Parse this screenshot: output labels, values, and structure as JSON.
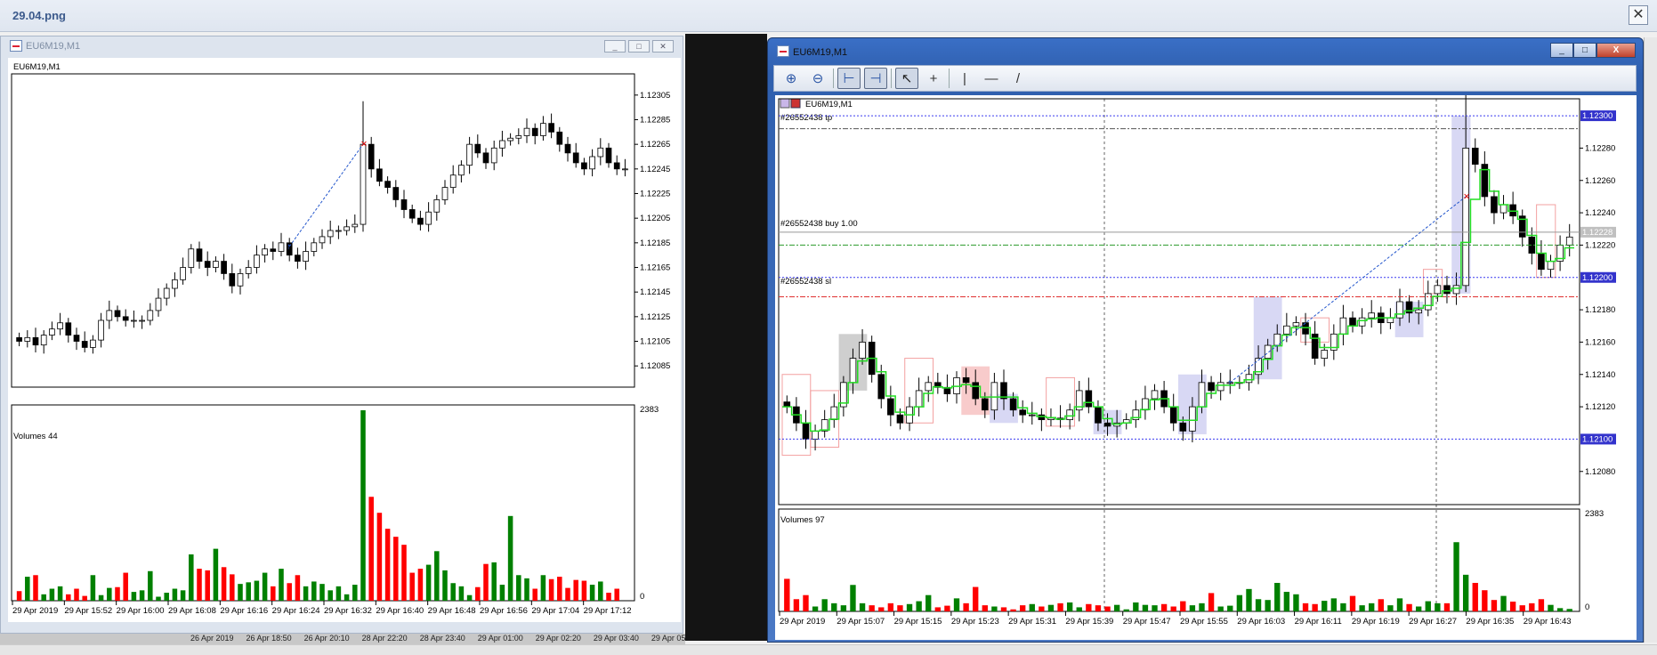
{
  "viewer": {
    "title": "29.04.png",
    "close_icon": "✕"
  },
  "left_window": {
    "title": "EU6M19,M1",
    "chart_label": "EU6M19,M1",
    "volumes_label": "Volumes 44",
    "price_ticks": [
      "1.12305",
      "1.12285",
      "1.12265",
      "1.12245",
      "1.12225",
      "1.12205",
      "1.12185",
      "1.12165",
      "1.12145",
      "1.12125",
      "1.12105",
      "1.12085"
    ],
    "price_range": [
      1.12075,
      1.12315
    ],
    "volume_ticks": [
      "2383",
      "0"
    ],
    "time_ticks": [
      "29 Apr 2019",
      "29 Apr 15:52",
      "29 Apr 16:00",
      "29 Apr 16:08",
      "29 Apr 16:16",
      "29 Apr 16:24",
      "29 Apr 16:32",
      "29 Apr 16:40",
      "29 Apr 16:48",
      "29 Apr 16:56",
      "29 Apr 17:04",
      "29 Apr 17:12"
    ],
    "closes": [
      1.12105,
      1.12108,
      1.12102,
      1.1211,
      1.12115,
      1.1212,
      1.1211,
      1.12105,
      1.121,
      1.12106,
      1.12122,
      1.1213,
      1.12125,
      1.12122,
      1.12122,
      1.12122,
      1.1213,
      1.1214,
      1.12148,
      1.12155,
      1.12165,
      1.1218,
      1.1217,
      1.12165,
      1.1217,
      1.1216,
      1.1215,
      1.1216,
      1.12165,
      1.12175,
      1.1218,
      1.12178,
      1.12185,
      1.12175,
      1.1217,
      1.12178,
      1.12185,
      1.1219,
      1.12195,
      1.12195,
      1.12198,
      1.122,
      1.12265,
      1.12245,
      1.12235,
      1.1223,
      1.1222,
      1.12212,
      1.12205,
      1.122,
      1.1221,
      1.1222,
      1.1223,
      1.1224,
      1.12248,
      1.12265,
      1.12258,
      1.1225,
      1.12262,
      1.12268,
      1.1227,
      1.12272,
      1.12278,
      1.12272,
      1.12282,
      1.12275,
      1.12265,
      1.12258,
      1.1225,
      1.12245,
      1.12255,
      1.12262,
      1.1225,
      1.12245,
      1.12245
    ],
    "volumes": [
      120,
      300,
      320,
      80,
      150,
      180,
      80,
      150,
      60,
      320,
      70,
      160,
      170,
      350,
      110,
      130,
      370,
      50,
      100,
      150,
      130,
      580,
      400,
      380,
      650,
      420,
      330,
      210,
      230,
      250,
      350,
      180,
      400,
      220,
      320,
      180,
      240,
      210,
      130,
      180,
      80,
      200,
      2383,
      1300,
      1100,
      900,
      800,
      700,
      350,
      400,
      450,
      620,
      380,
      220,
      180,
      70,
      170,
      460,
      480,
      200,
      1060,
      320,
      280,
      150,
      320,
      270,
      300,
      160,
      260,
      250,
      200,
      240,
      100,
      150
    ]
  },
  "right_window": {
    "title": "EU6M19,M1",
    "chart_label": "EU6M19,M1",
    "volumes_label": "Volumes 97",
    "toolbar": {
      "zoom_in": "⊕",
      "zoom_out": "⊖",
      "crosshair": "+",
      "vline": "|",
      "hline": "—",
      "trendline": "/"
    },
    "orders": {
      "tp": "#26552438 tp",
      "buy": "#26552438 buy 1.00",
      "sl": "#26552438 sl"
    },
    "price_ticks": [
      "1.12280",
      "1.12260",
      "1.12240",
      "1.12220",
      "1.12180",
      "1.12160",
      "1.12140",
      "1.12120",
      "1.12080"
    ],
    "price_range": [
      1.12065,
      1.12305
    ],
    "levels": {
      "tp": 1.12292,
      "buy": 1.1222,
      "sl": 1.12188,
      "upper": 1.123,
      "mid": 1.122,
      "lower": 1.121,
      "current": 1.12228
    },
    "level_labels": {
      "upper": "1.12300",
      "mid": "1.12200",
      "lower": "1.12100",
      "current": "1.12228"
    },
    "volume_ticks": [
      "2383",
      "0"
    ],
    "time_ticks": [
      "29 Apr 2019",
      "29 Apr 15:07",
      "29 Apr 15:15",
      "29 Apr 15:23",
      "29 Apr 15:31",
      "29 Apr 15:39",
      "29 Apr 15:47",
      "29 Apr 15:55",
      "29 Apr 16:03",
      "29 Apr 16:11",
      "29 Apr 16:19",
      "29 Apr 16:27",
      "29 Apr 16:35",
      "29 Apr 16:43"
    ],
    "closes": [
      1.1212,
      1.1211,
      1.121,
      1.12105,
      1.12112,
      1.1212,
      1.12135,
      1.1215,
      1.1216,
      1.1214,
      1.12125,
      1.12115,
      1.1211,
      1.1212,
      1.1213,
      1.12135,
      1.12132,
      1.12128,
      1.12138,
      1.12135,
      1.12125,
      1.12118,
      1.12135,
      1.12125,
      1.12118,
      1.12115,
      1.12115,
      1.12112,
      1.12113,
      1.12112,
      1.12118,
      1.1213,
      1.1212,
      1.1211,
      1.12108,
      1.1211,
      1.12112,
      1.12118,
      1.12125,
      1.1213,
      1.1212,
      1.1211,
      1.12105,
      1.1212,
      1.12135,
      1.1213,
      1.12135,
      1.12135,
      1.12135,
      1.1214,
      1.1215,
      1.12158,
      1.12165,
      1.1217,
      1.12172,
      1.12165,
      1.1215,
      1.12155,
      1.12165,
      1.12175,
      1.1217,
      1.12175,
      1.12178,
      1.12172,
      1.12175,
      1.12185,
      1.12178,
      1.1218,
      1.1219,
      1.12195,
      1.1219,
      1.12195,
      1.1228,
      1.1227,
      1.1225,
      1.1224,
      1.12245,
      1.12238,
      1.12225,
      1.12215,
      1.12205,
      1.1221,
      1.1222,
      1.12225
    ],
    "volumes": [
      800,
      300,
      400,
      120,
      300,
      200,
      150,
      650,
      200,
      150,
      100,
      200,
      150,
      180,
      250,
      400,
      100,
      140,
      320,
      200,
      600,
      150,
      120,
      100,
      50,
      150,
      180,
      120,
      160,
      200,
      220,
      100,
      180,
      150,
      120,
      160,
      50,
      220,
      160,
      150,
      180,
      120,
      250,
      150,
      200,
      450,
      120,
      140,
      400,
      550,
      300,
      280,
      700,
      480,
      420,
      200,
      180,
      260,
      320,
      200,
      380,
      150,
      200,
      300,
      150,
      320,
      180,
      120,
      250,
      200,
      200,
      1700,
      900,
      700,
      520,
      280,
      380,
      240,
      150,
      200,
      300,
      160,
      80,
      60
    ],
    "volume_max": 2383
  }
}
